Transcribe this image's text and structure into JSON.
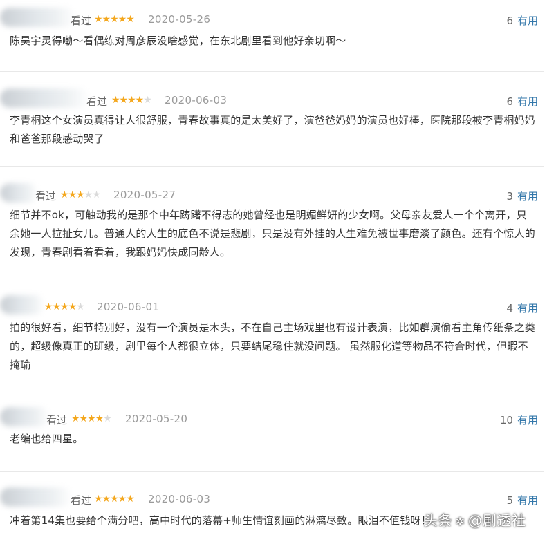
{
  "reviews": [
    {
      "status": "看过",
      "stars": 5,
      "date": "2020-05-26",
      "votes": "6",
      "useful": "有用",
      "text": "陈昊宇灵得嘞～看偶练对周彦辰没啥感觉，在东北剧里看到他好亲切啊～"
    },
    {
      "status": "看过",
      "stars": 4,
      "date": "2020-06-03",
      "votes": "6",
      "useful": "有用",
      "text": "李青桐这个女演员真得让人很舒服，青春故事真的是太美好了，演爸爸妈妈的演员也好棒，医院那段被李青桐妈妈和爸爸那段感动哭了"
    },
    {
      "status": "看过",
      "stars": 3,
      "date": "2020-05-27",
      "votes": "3",
      "useful": "有用",
      "text": "细节并不ok，可触动我的是那个中年踌躇不得志的她曾经也是明媚鲜妍的少女啊。父母亲友爱人一个个离开，只余她一人拉扯女儿。普通人的人生的底色不说是悲剧，只是没有外挂的人生难免被世事磨淡了颜色。还有个惊人的发现，青春剧看着看着，我跟妈妈快成同龄人。"
    },
    {
      "status": "",
      "stars": 4,
      "date": "2020-06-01",
      "votes": "4",
      "useful": "有用",
      "text": "拍的很好看，细节特别好，没有一个演员是木头，不在自己主场戏里也有设计表演，比如群演偷看主角传纸条之类的，超级像真正的班级，剧里每个人都很立体，只要结尾稳住就没问题。 虽然服化道等物品不符合时代，但瑕不掩瑜"
    },
    {
      "status": "看过",
      "stars": 4,
      "date": "2020-05-20",
      "votes": "10",
      "useful": "有用",
      "text": "老编也给四星。"
    },
    {
      "status": "看过",
      "stars": 5,
      "date": "2020-06-03",
      "votes": "5",
      "useful": "有用",
      "text": "冲着第14集也要给个满分吧，高中时代的落幕+师生情谊刻画的淋漓尽致。眼泪不值钱呀！"
    }
  ],
  "watermark": {
    "prefix": "头条",
    "at": "@",
    "name": "剧透社"
  }
}
